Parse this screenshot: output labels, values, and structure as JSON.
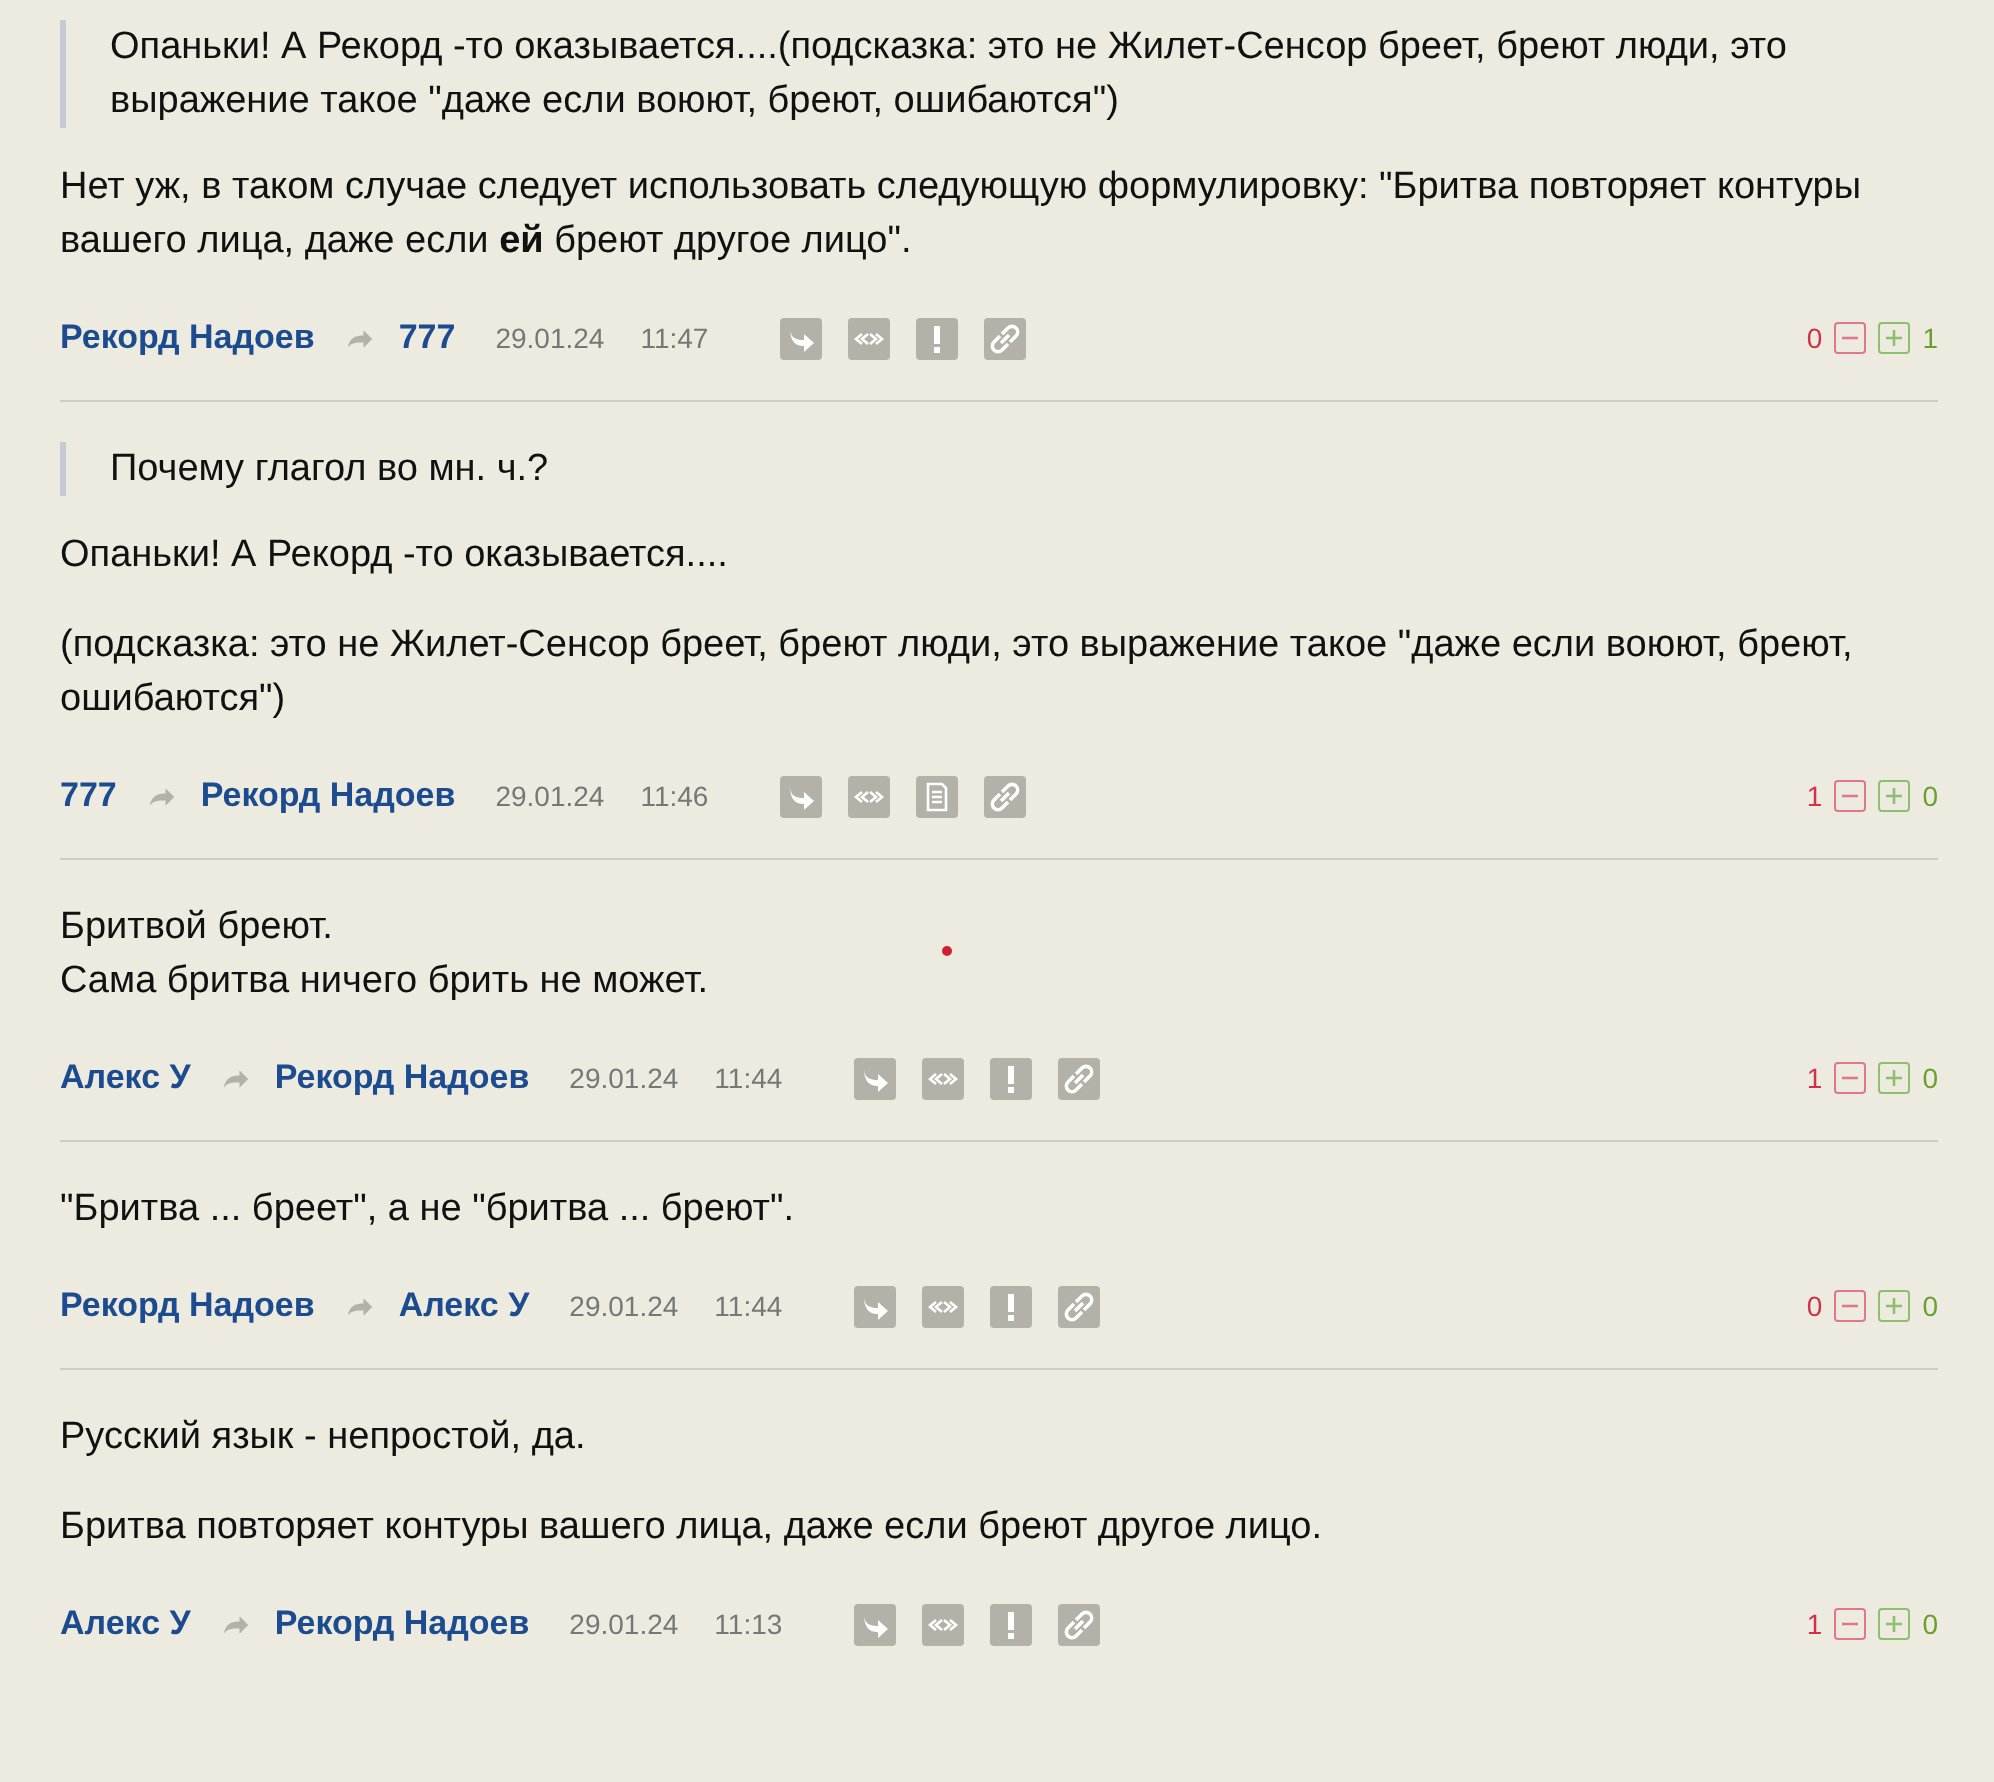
{
  "comments": [
    {
      "quote": "Опаньки! А Рекорд -то оказывается....(подсказка: это не Жилет-Сенсор бреет, бреют люди, это выражение такое \"даже если воюют, бреют, ошибаются\")",
      "paragraphs": [
        "Нет уж, в таком случае следует использовать следующую формулировку: \"Бритва повторяет контуры вашего лица, даже если **ей** бреют другое лицо\"."
      ],
      "author": "Рекорд Надоев",
      "reply_to": "777",
      "date": "29.01.24",
      "time": "11:47",
      "kind": "report",
      "minus": "0",
      "plus": "1"
    },
    {
      "quote": "Почему глагол во мн. ч.?",
      "paragraphs": [
        "Опаньки! А Рекорд -то оказывается....",
        "(подсказка: это не Жилет-Сенсор бреет, бреют люди, это выражение такое \"даже если воюют, бреют, ошибаются\")"
      ],
      "author": "777",
      "reply_to": "Рекорд Надоев",
      "date": "29.01.24",
      "time": "11:46",
      "kind": "note",
      "minus": "1",
      "plus": "0"
    },
    {
      "paragraphs": [
        "Бритвой бреют.\nСама бритва ничего брить не может."
      ],
      "author": "Алекс У",
      "reply_to": "Рекорд Надоев",
      "date": "29.01.24",
      "time": "11:44",
      "kind": "report",
      "minus": "1",
      "plus": "0"
    },
    {
      "paragraphs": [
        "\"Бритва ... бреет\", а не \"бритва ... бреют\"."
      ],
      "author": "Рекорд Надоев",
      "reply_to": "Алекс У",
      "date": "29.01.24",
      "time": "11:44",
      "kind": "report",
      "minus": "0",
      "plus": "0"
    },
    {
      "paragraphs": [
        "Русский язык - непростой, да.",
        "Бритва повторяет контуры вашего лица, даже если бреют другое лицо."
      ],
      "author": "Алекс У",
      "reply_to": "Рекорд Надоев",
      "date": "29.01.24",
      "time": "11:13",
      "kind": "report",
      "minus": "1",
      "plus": "0"
    }
  ]
}
